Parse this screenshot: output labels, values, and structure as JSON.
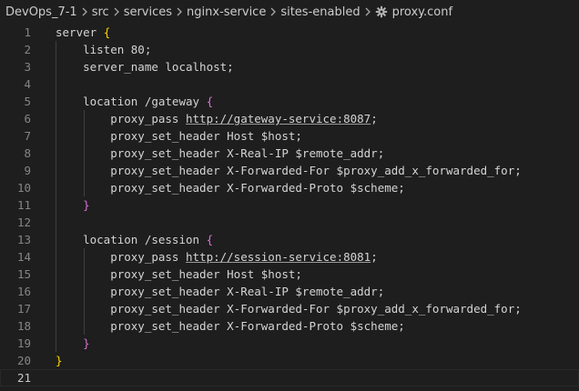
{
  "breadcrumb": {
    "items": [
      "DevOps_7-1",
      "src",
      "services",
      "nginx-service",
      "sites-enabled"
    ],
    "file": "proxy.conf",
    "file_icon": "gear-icon"
  },
  "editor": {
    "current_line": "21",
    "lines": [
      {
        "n": "1",
        "t": "server "
      },
      {
        "n": "2",
        "t": "    listen 80;"
      },
      {
        "n": "3",
        "t": "    server_name localhost;"
      },
      {
        "n": "4",
        "t": ""
      },
      {
        "n": "5",
        "t": "    location /gateway "
      },
      {
        "n": "6",
        "t": "        proxy_pass ",
        "url": "http://gateway-service:8087",
        "after": ";"
      },
      {
        "n": "7",
        "t": "        proxy_set_header Host $host;"
      },
      {
        "n": "8",
        "t": "        proxy_set_header X-Real-IP $remote_addr;"
      },
      {
        "n": "9",
        "t": "        proxy_set_header X-Forwarded-For $proxy_add_x_forwarded_for;"
      },
      {
        "n": "10",
        "t": "        proxy_set_header X-Forwarded-Proto $scheme;"
      },
      {
        "n": "11",
        "t": "    "
      },
      {
        "n": "12",
        "t": ""
      },
      {
        "n": "13",
        "t": "    location /session "
      },
      {
        "n": "14",
        "t": "        proxy_pass ",
        "url": "http://session-service:8081",
        "after": ";"
      },
      {
        "n": "15",
        "t": "        proxy_set_header Host $host;"
      },
      {
        "n": "16",
        "t": "        proxy_set_header X-Real-IP $remote_addr;"
      },
      {
        "n": "17",
        "t": "        proxy_set_header X-Forwarded-For $proxy_add_x_forwarded_for;"
      },
      {
        "n": "18",
        "t": "        proxy_set_header X-Forwarded-Proto $scheme;"
      },
      {
        "n": "19",
        "t": "    "
      },
      {
        "n": "20",
        "t": ""
      },
      {
        "n": "21",
        "t": ""
      }
    ],
    "braces": {
      "1": {
        "char": "{",
        "color": "gold"
      },
      "5": {
        "char": "{",
        "color": "pink"
      },
      "11": {
        "char": "}",
        "color": "pink"
      },
      "13": {
        "char": "{",
        "color": "pink"
      },
      "19": {
        "char": "}",
        "color": "pink"
      },
      "20": {
        "char": "}",
        "color": "gold"
      }
    },
    "colors": {
      "background": "#1e1e1e",
      "text": "#d4d4d4",
      "line_number": "#858585",
      "brace_outer": "#ffd700",
      "brace_inner": "#da70d6"
    }
  }
}
